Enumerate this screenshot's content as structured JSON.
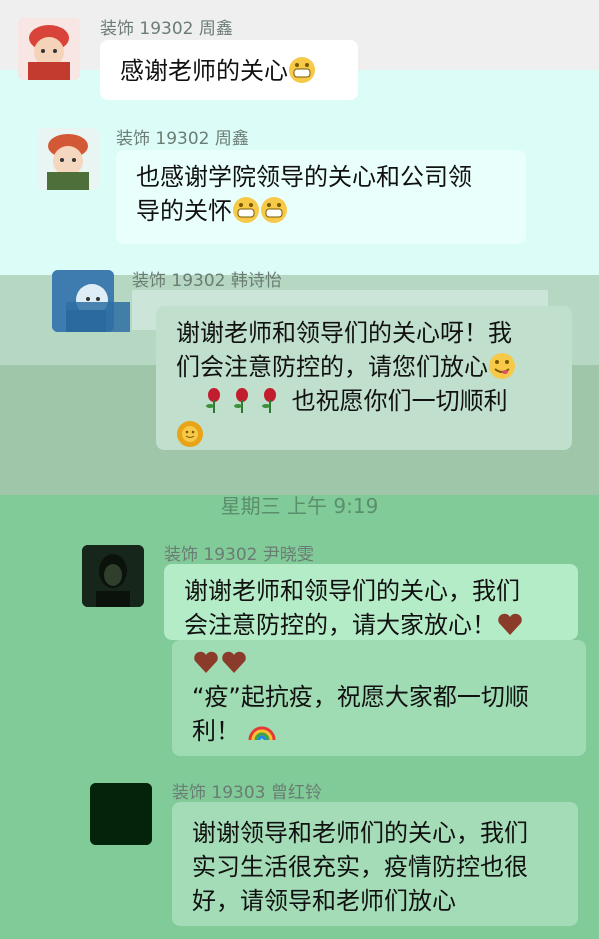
{
  "messages": [
    {
      "sender": "装饰 19302 周鑫",
      "lines": [
        "感谢老师的关心"
      ],
      "emoji": [
        "grin-face-icon"
      ]
    },
    {
      "sender": "装饰 19302 周鑫",
      "lines": [
        "也感谢学院领导的关心和公司领",
        "导的关怀"
      ],
      "emoji": [
        "grin-face-icon",
        "grin-face-icon"
      ]
    },
    {
      "sender": "装饰 19302 韩诗怡",
      "lines": [
        "谢谢老师和领导们的关心呀！我",
        "们会注意防控的，请您们放心",
        "也祝愿你们一切顺利"
      ],
      "emoji": [
        "yum-face-icon",
        "rose-icon",
        "rose-icon",
        "rose-icon",
        "sun-face-icon"
      ]
    },
    {
      "sender": "装饰 19302 尹晓雯",
      "lines": [
        "谢谢老师和领导们的关心，我们",
        "会注意防控的，请大家放心！",
        "“疫”起抗疫，祝愿大家都一切顺",
        "利！"
      ],
      "emoji": [
        "heart-icon",
        "heart-icon",
        "heart-icon",
        "rainbow-icon"
      ]
    },
    {
      "sender": "装饰 19303 曾红铃",
      "lines": [
        "谢谢领导和老师们的关心，我们",
        "实习生活很充实，疫情防控也很",
        "好，请领导和老师们放心"
      ],
      "emoji": []
    }
  ],
  "timestamp": "星期三 上午 9:19",
  "colors": {
    "band_top": "#efefef",
    "band_cyan": "#dcfcf8",
    "band_sage": "#9ec4a8",
    "band_green": "#7fcf9a",
    "bubble": "#ffffff"
  }
}
